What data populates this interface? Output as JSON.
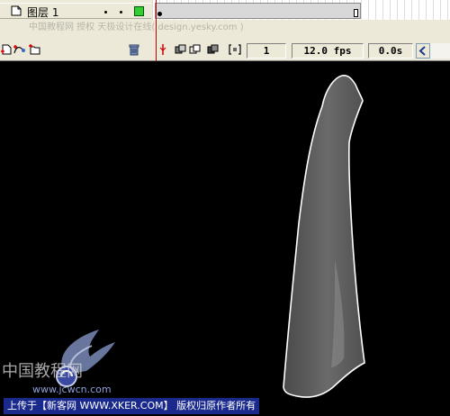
{
  "timeline": {
    "layer_name": "图层 1",
    "watermark": "中国教程网 授权 天极设计在线( design.yesky.com )",
    "current_frame": "1",
    "frame_rate": "12.0 fps",
    "elapsed_time": "0.0s",
    "layer_outline_color": "#33cc33",
    "playhead_color": "#cc0000"
  },
  "icons": {
    "layer": "layer-icon",
    "insert_layer": "insert-layer-icon",
    "motion_guide": "motion-guide-icon",
    "insert_folder": "insert-folder-icon",
    "trash": "trash-icon",
    "center_frame": "center-frame-icon",
    "onion_skin": "onion-skin-icon",
    "onion_outline": "onion-outline-icon",
    "edit_multiple": "edit-multiple-frames-icon",
    "onion_markers": "onion-markers-icon",
    "scroll_left": "scroll-left-icon"
  },
  "stage": {
    "background": "#000000",
    "shape_fill": "#5a5a5a",
    "shape_stroke": "#ffffff"
  },
  "logo": {
    "text": "中国教程网",
    "url_text": "www.jcwcn.com"
  },
  "banner": {
    "text": "上传于【新客网 WWW.XKER.COM】 版权归原作者所有",
    "background": "#1a2a8c"
  }
}
